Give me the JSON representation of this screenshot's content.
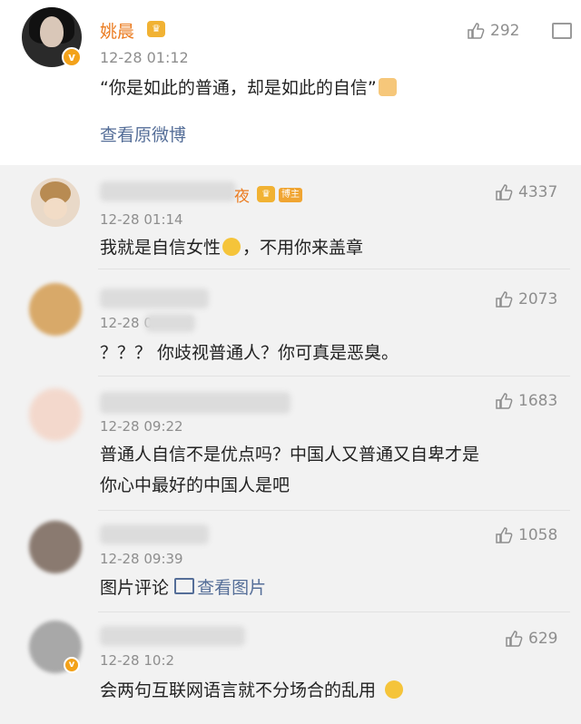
{
  "post": {
    "author": "姚晨",
    "time": "12-28 01:12",
    "text": "“你是如此的普通，却是如此的自信”",
    "likes": "292",
    "view_original": "查看原微博",
    "badge_icon": "v-verified-icon",
    "accent": "#eb7b1f"
  },
  "comments": [
    {
      "name_visible": "夜",
      "tag": "博主",
      "time": "12-28 01:14",
      "likes": "4337",
      "text_a": "我就是自信女性",
      "text_b": "，不用你来盖章"
    },
    {
      "time": "12-28 0",
      "likes": "2073",
      "text": "？？？ 你歧视普通人？你可真是恶臭。"
    },
    {
      "time": "12-28 09:22",
      "likes": "1683",
      "text_line1": "普通人自信不是优点吗？中国人又普通又自卑才是",
      "text_line2": "你心中最好的中国人是吧"
    },
    {
      "time": "12-28 09:39",
      "likes": "1058",
      "text": "图片评论",
      "link": "查看图片"
    },
    {
      "time": "12-28 10:2",
      "likes": "629",
      "text": "会两句互联网语言就不分场合的乱用"
    }
  ],
  "colors": {
    "link": "#556e98",
    "meta": "#8e8e8e",
    "comment_bg": "#f2f2f2"
  }
}
